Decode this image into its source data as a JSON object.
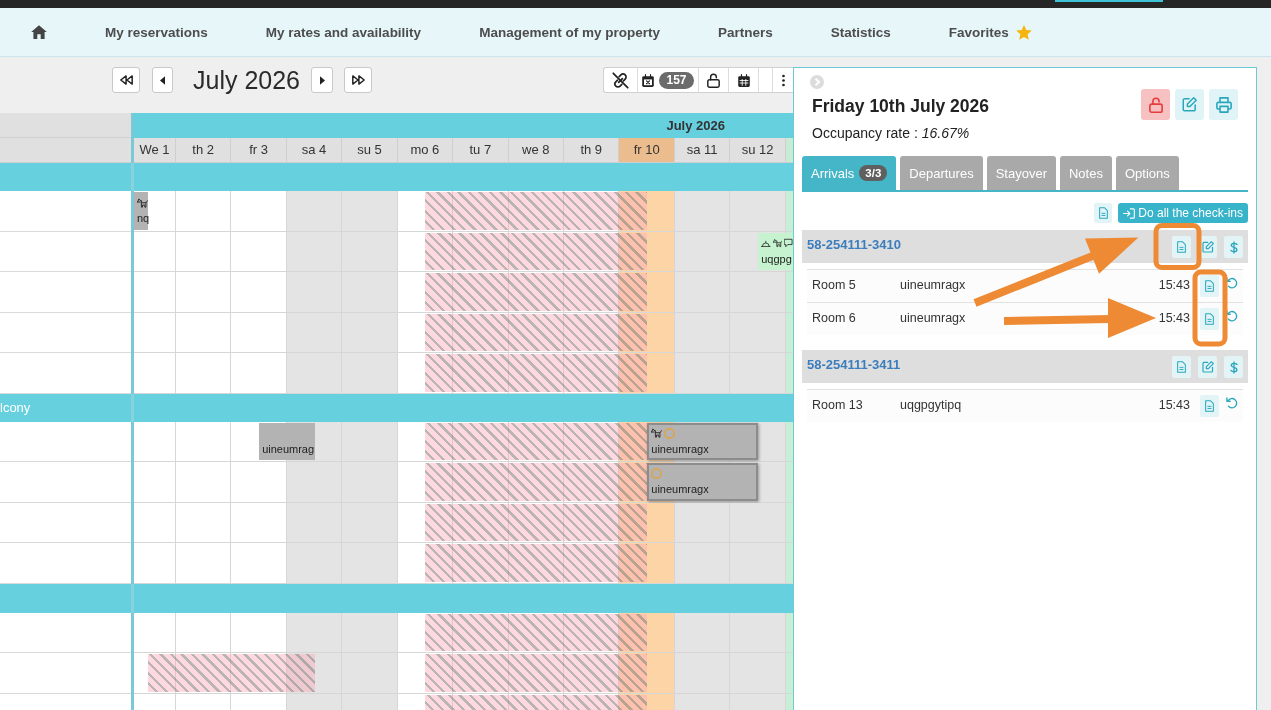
{
  "nav": {
    "items": [
      {
        "kind": "home"
      },
      {
        "kind": "link",
        "label": "My reservations",
        "starred": false
      },
      {
        "kind": "link",
        "label": "My rates and availability",
        "starred": false
      },
      {
        "kind": "link",
        "label": "Management of my property",
        "starred": false
      },
      {
        "kind": "link",
        "label": "Partners",
        "starred": false
      },
      {
        "kind": "link",
        "label": "Statistics",
        "starred": false
      },
      {
        "kind": "link",
        "label": "Favorites",
        "starred": true
      }
    ]
  },
  "toolbar": {
    "period": "July 2026",
    "tools": [
      {
        "kind": "unlink"
      },
      {
        "kind": "calendar-x",
        "count": "157"
      },
      {
        "kind": "unlock"
      },
      {
        "kind": "calendar"
      },
      {
        "kind": "blank"
      },
      {
        "kind": "menu"
      }
    ]
  },
  "calendar": {
    "month": "July 2026",
    "days": [
      {
        "label": "We 1",
        "weekend": false,
        "selected": false
      },
      {
        "label": "th 2",
        "weekend": false,
        "selected": false
      },
      {
        "label": "fr 3",
        "weekend": false,
        "selected": false
      },
      {
        "label": "sa 4",
        "weekend": true,
        "selected": false
      },
      {
        "label": "su 5",
        "weekend": true,
        "selected": false
      },
      {
        "label": "mo 6",
        "weekend": false,
        "selected": false
      },
      {
        "label": "tu 7",
        "weekend": false,
        "selected": false
      },
      {
        "label": "we 8",
        "weekend": false,
        "selected": false
      },
      {
        "label": "th 9",
        "weekend": false,
        "selected": false
      },
      {
        "label": "fr 10",
        "weekend": false,
        "selected": true
      },
      {
        "label": "sa 11",
        "weekend": true,
        "selected": false
      },
      {
        "label": "su 12",
        "weekend": true,
        "selected": false
      }
    ],
    "groups": [
      {
        "rows": [
          {
            "nights": [
              {
                "kind": "booked",
                "booking": {
                  "guest": "nq",
                  "color": "#b3b3b3",
                  "selected": false,
                  "badges": [
                    {
                      "kind": "dog"
                    }
                  ]
                }
              },
              {
                "kind": "free"
              },
              {
                "kind": "free"
              },
              {
                "kind": "free"
              },
              {
                "kind": "free"
              },
              {
                "kind": "free"
              },
              {
                "kind": "blocked"
              },
              {
                "kind": "blocked"
              },
              {
                "kind": "blocked"
              },
              {
                "kind": "blocked"
              },
              {
                "kind": "free"
              },
              {
                "kind": "free"
              },
              {
                "kind": "free"
              }
            ]
          },
          {
            "nights": [
              {
                "kind": "free"
              },
              {
                "kind": "free"
              },
              {
                "kind": "free"
              },
              {
                "kind": "free"
              },
              {
                "kind": "free"
              },
              {
                "kind": "free"
              },
              {
                "kind": "blocked"
              },
              {
                "kind": "blocked"
              },
              {
                "kind": "blocked"
              },
              {
                "kind": "blocked"
              },
              {
                "kind": "free"
              },
              {
                "kind": "free"
              },
              {
                "kind": "booked",
                "booking": {
                  "guest": "uqgpg",
                  "color": "#c6f2cf",
                  "selected": false,
                  "badges": [
                    {
                      "kind": "bell"
                    },
                    {
                      "kind": "dog"
                    },
                    {
                      "kind": "chat"
                    }
                  ]
                }
              }
            ]
          },
          {
            "nights": [
              {
                "kind": "free"
              },
              {
                "kind": "free"
              },
              {
                "kind": "free"
              },
              {
                "kind": "free"
              },
              {
                "kind": "free"
              },
              {
                "kind": "free"
              },
              {
                "kind": "blocked"
              },
              {
                "kind": "blocked"
              },
              {
                "kind": "blocked"
              },
              {
                "kind": "blocked"
              },
              {
                "kind": "free"
              },
              {
                "kind": "free"
              },
              {
                "kind": "free"
              }
            ]
          },
          {
            "nights": [
              {
                "kind": "free"
              },
              {
                "kind": "free"
              },
              {
                "kind": "free"
              },
              {
                "kind": "free"
              },
              {
                "kind": "free"
              },
              {
                "kind": "free"
              },
              {
                "kind": "blocked"
              },
              {
                "kind": "blocked"
              },
              {
                "kind": "blocked"
              },
              {
                "kind": "blocked"
              },
              {
                "kind": "free"
              },
              {
                "kind": "free"
              },
              {
                "kind": "free"
              }
            ]
          },
          {
            "nights": [
              {
                "kind": "free"
              },
              {
                "kind": "free"
              },
              {
                "kind": "free"
              },
              {
                "kind": "free"
              },
              {
                "kind": "free"
              },
              {
                "kind": "free"
              },
              {
                "kind": "blocked"
              },
              {
                "kind": "blocked"
              },
              {
                "kind": "blocked"
              },
              {
                "kind": "blocked"
              },
              {
                "kind": "free"
              },
              {
                "kind": "free"
              },
              {
                "kind": "free"
              }
            ]
          }
        ]
      },
      {
        "name": "lcony",
        "rows": [
          {
            "nights": [
              {
                "kind": "free"
              },
              {
                "kind": "free"
              },
              {
                "kind": "free"
              },
              {
                "kind": "booked",
                "booking": {
                  "guest": "uineumrag",
                  "color": "#b3b3b3",
                  "selected": false
                }
              },
              {
                "kind": "free"
              },
              {
                "kind": "free"
              },
              {
                "kind": "blocked"
              },
              {
                "kind": "blocked"
              },
              {
                "kind": "blocked"
              },
              {
                "kind": "blocked"
              },
              {
                "kind": "booked",
                "booking": {
                  "guest": "uineumragx",
                  "color": "#b3b3b3",
                  "selected": true,
                  "badges": [
                    {
                      "kind": "dog"
                    },
                    {
                      "kind": "ring"
                    }
                  ]
                }
              },
              {
                "kind": "booked"
              },
              {
                "kind": "free"
              }
            ]
          },
          {
            "nights": [
              {
                "kind": "free"
              },
              {
                "kind": "free"
              },
              {
                "kind": "free"
              },
              {
                "kind": "free"
              },
              {
                "kind": "free"
              },
              {
                "kind": "free"
              },
              {
                "kind": "blocked"
              },
              {
                "kind": "blocked"
              },
              {
                "kind": "blocked"
              },
              {
                "kind": "blocked"
              },
              {
                "kind": "booked",
                "booking": {
                  "guest": "uineumragx",
                  "color": "#b3b3b3",
                  "selected": true,
                  "badges": [
                    {
                      "kind": "ring"
                    }
                  ]
                }
              },
              {
                "kind": "booked"
              },
              {
                "kind": "free"
              }
            ]
          },
          {
            "nights": [
              {
                "kind": "free"
              },
              {
                "kind": "free"
              },
              {
                "kind": "free"
              },
              {
                "kind": "free"
              },
              {
                "kind": "free"
              },
              {
                "kind": "free"
              },
              {
                "kind": "blocked"
              },
              {
                "kind": "blocked"
              },
              {
                "kind": "blocked"
              },
              {
                "kind": "blocked"
              },
              {
                "kind": "free"
              },
              {
                "kind": "free"
              },
              {
                "kind": "free"
              }
            ]
          },
          {
            "nights": [
              {
                "kind": "free"
              },
              {
                "kind": "free"
              },
              {
                "kind": "free"
              },
              {
                "kind": "free"
              },
              {
                "kind": "free"
              },
              {
                "kind": "free"
              },
              {
                "kind": "blocked"
              },
              {
                "kind": "blocked"
              },
              {
                "kind": "blocked"
              },
              {
                "kind": "blocked"
              },
              {
                "kind": "free"
              },
              {
                "kind": "free"
              },
              {
                "kind": "free"
              }
            ]
          }
        ]
      },
      {
        "rows": [
          {
            "nights": [
              {
                "kind": "free"
              },
              {
                "kind": "free"
              },
              {
                "kind": "free"
              },
              {
                "kind": "free"
              },
              {
                "kind": "free"
              },
              {
                "kind": "free"
              },
              {
                "kind": "blocked"
              },
              {
                "kind": "blocked"
              },
              {
                "kind": "blocked"
              },
              {
                "kind": "blocked"
              },
              {
                "kind": "free"
              },
              {
                "kind": "free"
              },
              {
                "kind": "free"
              }
            ]
          },
          {
            "nights": [
              {
                "kind": "free"
              },
              {
                "kind": "blocked"
              },
              {
                "kind": "blocked"
              },
              {
                "kind": "blocked"
              },
              {
                "kind": "free"
              },
              {
                "kind": "free"
              },
              {
                "kind": "blocked"
              },
              {
                "kind": "blocked"
              },
              {
                "kind": "blocked"
              },
              {
                "kind": "blocked"
              },
              {
                "kind": "free"
              },
              {
                "kind": "free"
              },
              {
                "kind": "free"
              }
            ]
          },
          {
            "nights": [
              {
                "kind": "free"
              },
              {
                "kind": "free"
              },
              {
                "kind": "free"
              },
              {
                "kind": "free"
              },
              {
                "kind": "free"
              },
              {
                "kind": "free"
              },
              {
                "kind": "blocked"
              },
              {
                "kind": "blocked"
              },
              {
                "kind": "blocked"
              },
              {
                "kind": "blocked"
              },
              {
                "kind": "free"
              },
              {
                "kind": "free"
              },
              {
                "kind": "free"
              }
            ]
          }
        ]
      }
    ]
  },
  "day_panel": {
    "title": "Friday 10th July 2026",
    "occupancy": "Occupancy rate : *16.67%*",
    "actions": [
      {
        "kind": "unlock"
      },
      {
        "kind": "edit"
      },
      {
        "kind": "print"
      }
    ],
    "tabs": [
      {
        "label": "Arrivals",
        "count": "3/3",
        "selected": true
      },
      {
        "label": "Departures",
        "selected": false
      },
      {
        "label": "Stayover",
        "selected": false
      },
      {
        "label": "Notes",
        "selected": false
      },
      {
        "label": "Options",
        "selected": false
      }
    ],
    "bulk_actions": [
      {
        "kind": "document"
      },
      {
        "kind": "check-in",
        "label": "Do all the check-ins"
      }
    ],
    "reservations": [
      {
        "reference": "58-254111-3410",
        "rooms": [
          {
            "room": "Room 5",
            "guest": "uineumragx",
            "time": "15:43"
          },
          {
            "room": "Room 6",
            "guest": "uineumragx",
            "time": "15:43"
          }
        ]
      },
      {
        "reference": "58-254111-3411",
        "rooms": [
          {
            "room": "Room 13",
            "guest": "uqgpgytipq",
            "time": "15:43"
          }
        ]
      }
    ]
  }
}
